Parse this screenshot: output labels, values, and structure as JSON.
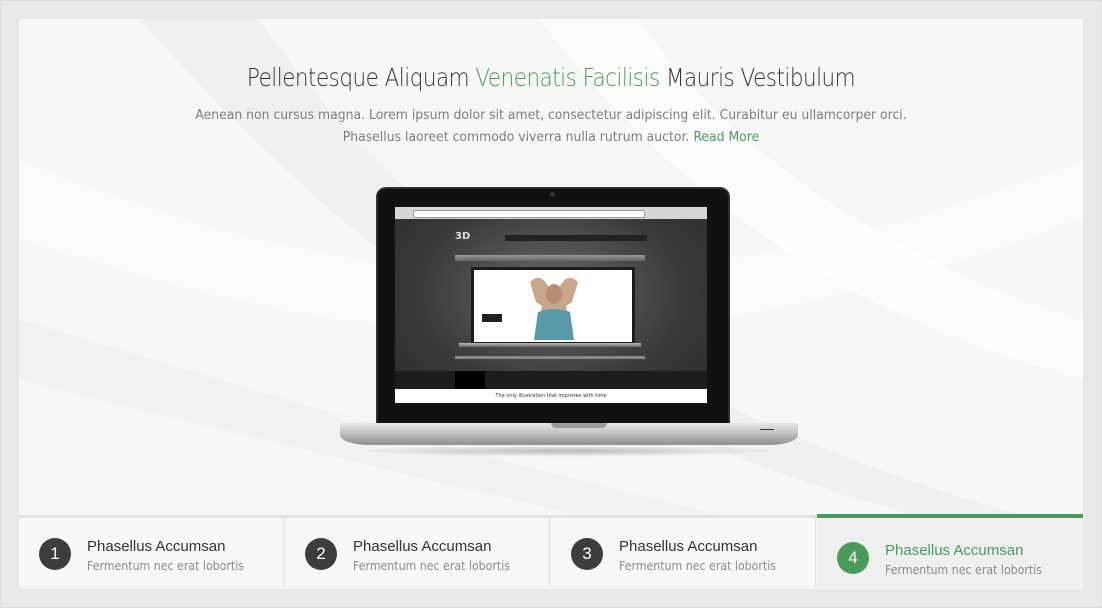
{
  "hero": {
    "title_part1": "Pellentesque Aliquam",
    "title_accent": "Venenatis Facilisis",
    "title_part2": "Mauris Vestibulum",
    "description": "Aenean non cursus magna. Lorem ipsum dolor sit amet, consectetur adipiscing elit. Curabitur eu ullamcorper orci. Phasellus laoreet commodo viverra nulla rutrum auctor.",
    "read_more": "Read More"
  },
  "laptop_screen": {
    "logo": "3D",
    "footer_line": "The only illustration that improves with time"
  },
  "tabs": [
    {
      "number": "1",
      "title": "Phasellus Accumsan",
      "subtitle": "Fermentum nec erat lobortis",
      "active": false
    },
    {
      "number": "2",
      "title": "Phasellus Accumsan",
      "subtitle": "Fermentum nec erat lobortis",
      "active": false
    },
    {
      "number": "3",
      "title": "Phasellus Accumsan",
      "subtitle": "Fermentum nec erat lobortis",
      "active": false
    },
    {
      "number": "4",
      "title": "Phasellus Accumsan",
      "subtitle": "Fermentum nec erat lobortis",
      "active": true
    }
  ],
  "colors": {
    "accent": "#4a9a5a",
    "dark_badge": "#3d3d3d",
    "text": "#333333",
    "muted": "#8a8a8a"
  }
}
